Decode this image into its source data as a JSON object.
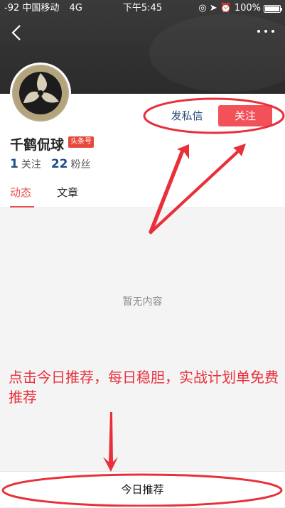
{
  "status_bar": {
    "carrier": "-92 中国移动",
    "network": "4G",
    "time": "下午5:45",
    "battery": "100%"
  },
  "header": {
    "back_icon": "chevron-left-icon",
    "more_icon": "more-horizontal-icon"
  },
  "profile": {
    "name": "千鹤侃球",
    "badge": "头条号",
    "following_count": "1",
    "following_label": "关注",
    "followers_count": "22",
    "followers_label": "粉丝",
    "message_button": "发私信",
    "follow_button": "关注"
  },
  "tabs": [
    {
      "label": "动态",
      "active": true
    },
    {
      "label": "文章",
      "active": false
    }
  ],
  "content": {
    "empty_text": "暂无内容"
  },
  "annotation": {
    "text": "点击今日推荐，每日稳胆，实战计划单免费推荐",
    "color": "#e8303a"
  },
  "bottom": {
    "button_label": "今日推荐"
  },
  "colors": {
    "accent": "#f2515a",
    "link": "#1f4e8c",
    "annotation": "#e8303a"
  }
}
